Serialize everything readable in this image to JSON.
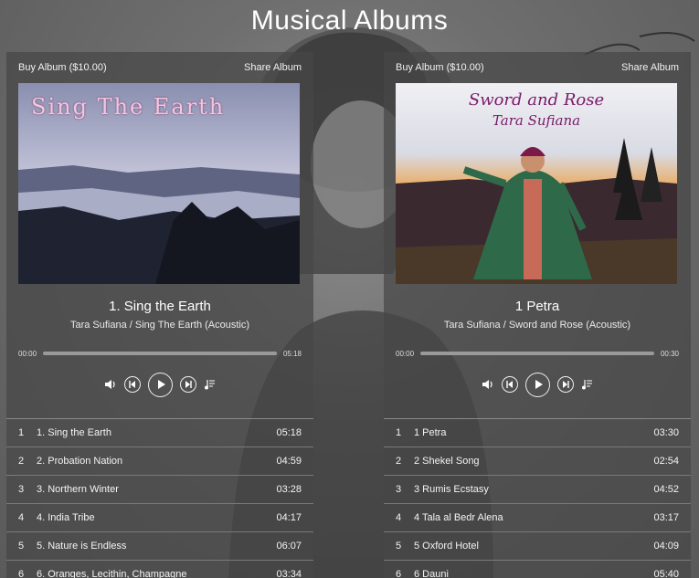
{
  "page": {
    "title": "Musical Albums"
  },
  "albums": [
    {
      "buy_label": "Buy Album ($10.00)",
      "share_label": "Share Album",
      "cover_text": "Sing The Earth",
      "now_playing": {
        "title": "1. Sing the Earth",
        "subtitle": "Tara Sufiana / Sing The Earth (Acoustic)"
      },
      "time_current": "00:00",
      "time_total": "05:18",
      "tracks": [
        {
          "num": "1",
          "name": "1. Sing the Earth",
          "dur": "05:18"
        },
        {
          "num": "2",
          "name": "2. Probation Nation",
          "dur": "04:59"
        },
        {
          "num": "3",
          "name": "3. Northern Winter",
          "dur": "03:28"
        },
        {
          "num": "4",
          "name": "4. India Tribe",
          "dur": "04:17"
        },
        {
          "num": "5",
          "name": "5. Nature is Endless",
          "dur": "06:07"
        },
        {
          "num": "6",
          "name": "6. Oranges, Lecithin, Champagne",
          "dur": "03:34"
        }
      ]
    },
    {
      "buy_label": "Buy Album ($10.00)",
      "share_label": "Share Album",
      "cover_text": "Sword and Rose",
      "cover_subtext": "Tara Sufiana",
      "now_playing": {
        "title": "1 Petra",
        "subtitle": "Tara Sufiana / Sword and Rose (Acoustic)"
      },
      "time_current": "00:00",
      "time_total": "00:30",
      "tracks": [
        {
          "num": "1",
          "name": "1 Petra",
          "dur": "03:30"
        },
        {
          "num": "2",
          "name": "2 Shekel Song",
          "dur": "02:54"
        },
        {
          "num": "3",
          "name": "3 Rumis Ecstasy",
          "dur": "04:52"
        },
        {
          "num": "4",
          "name": "4 Tala al Bedr Alena",
          "dur": "03:17"
        },
        {
          "num": "5",
          "name": "5 Oxford Hotel",
          "dur": "04:09"
        },
        {
          "num": "6",
          "name": "6 Dauni",
          "dur": "05:40"
        }
      ]
    }
  ]
}
